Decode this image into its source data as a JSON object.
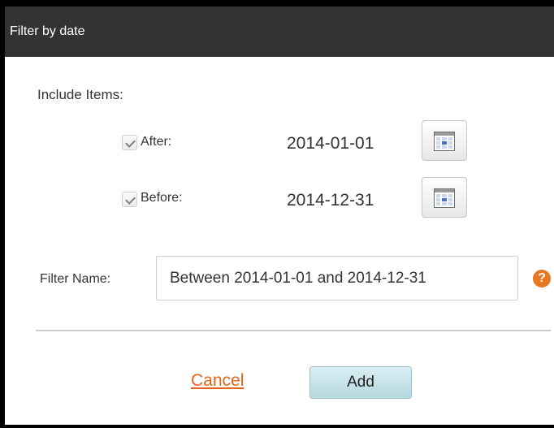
{
  "dialog": {
    "title": "Filter by date"
  },
  "include": {
    "label": "Include Items:",
    "after": {
      "checked": true,
      "label": "After:",
      "date": "2014-01-01"
    },
    "before": {
      "checked": true,
      "label": "Before:",
      "date": "2014-12-31"
    }
  },
  "filter_name": {
    "label": "Filter Name:",
    "value": "Between 2014-01-01 and 2014-12-31"
  },
  "help_icon_text": "?",
  "actions": {
    "cancel_label": "Cancel",
    "add_label": "Add"
  },
  "colors": {
    "title_bar": "#333333",
    "link": "#e8641e",
    "help_icon": "#e87722",
    "add_button": "#c5e3e9"
  },
  "icons": {
    "checkbox_check": "check-icon",
    "calendar": "calendar-icon",
    "help": "help-icon"
  }
}
